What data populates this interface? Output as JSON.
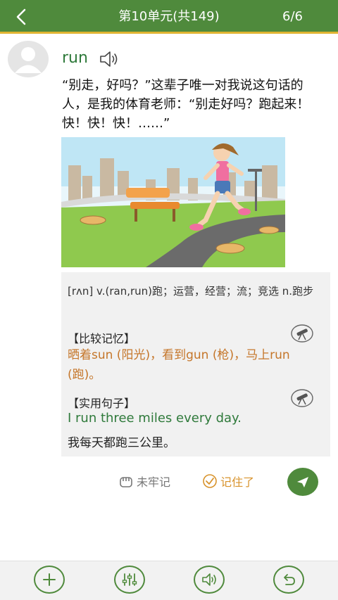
{
  "header": {
    "title": "第10单元(共149)",
    "counter": "6/6",
    "back_icon": "chevron-left-icon"
  },
  "card": {
    "word": "run",
    "sentence": "“别走，好吗？”这辈子唯一对我说这句话的人，是我的体育老师：“别走好吗？跑起来！快！快！快！……”",
    "pronunciation": "[rʌn] v.(ran,run)跑；运营，经营；流；竞选 n.跑步",
    "compare_title": "【比较记忆】",
    "compare_text": "晒着sun (阳光)，看到gun (枪)，马上run (跑)。",
    "example_title": "【实用句子】",
    "example_en": "I run three miles every day.",
    "example_zh": "我每天都跑三公里。"
  },
  "actions": {
    "not_remembered": "未牢记",
    "remembered": "记住了"
  },
  "colors": {
    "brand_green": "#4f8a3c",
    "accent_yellow": "#e0b432",
    "word_green": "#2f7a3b",
    "memo_orange": "#c5762a",
    "remember_orange": "#d8932c"
  },
  "icons": [
    "chevron-left-icon",
    "avatar-icon",
    "speaker-icon",
    "telescope-icon",
    "fist-icon",
    "check-circle-icon",
    "send-icon",
    "plus-icon",
    "sliders-icon",
    "undo-icon"
  ]
}
